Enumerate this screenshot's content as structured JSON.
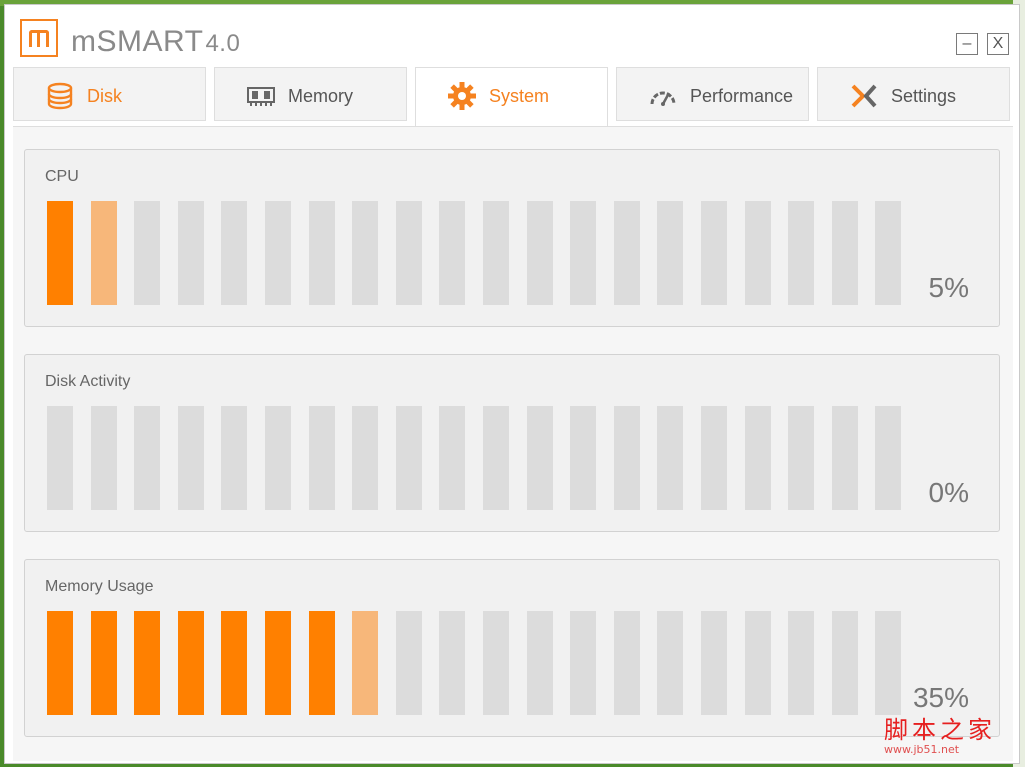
{
  "app": {
    "title": "mSMART",
    "version": "4.0"
  },
  "window_controls": {
    "minimize": "–",
    "close": "X"
  },
  "tabs": [
    {
      "label": "Disk",
      "icon": "database-icon",
      "accent": "orange"
    },
    {
      "label": "Memory",
      "icon": "memory-chip-icon",
      "accent": "gray"
    },
    {
      "label": "System",
      "icon": "gear-icon",
      "accent": "orange",
      "active": true
    },
    {
      "label": "Performance",
      "icon": "speedometer-icon",
      "accent": "gray"
    },
    {
      "label": "Settings",
      "icon": "settings-x-icon",
      "accent": "gray"
    }
  ],
  "panels": [
    {
      "title": "CPU",
      "percent": "5%",
      "total_bars": 20,
      "lit_bars": 1,
      "partial_bars": 1
    },
    {
      "title": "Disk Activity",
      "percent": "0%",
      "total_bars": 20,
      "lit_bars": 0,
      "partial_bars": 0
    },
    {
      "title": "Memory Usage",
      "percent": "35%",
      "total_bars": 20,
      "lit_bars": 7,
      "partial_bars": 1
    }
  ],
  "watermark": {
    "text": "脚本之家",
    "url": "www.jb51.net"
  },
  "colors": {
    "accent": "#ff8000",
    "accent_light": "#f7b77a",
    "bar_off": "#dcdcdc",
    "text": "#555555"
  }
}
